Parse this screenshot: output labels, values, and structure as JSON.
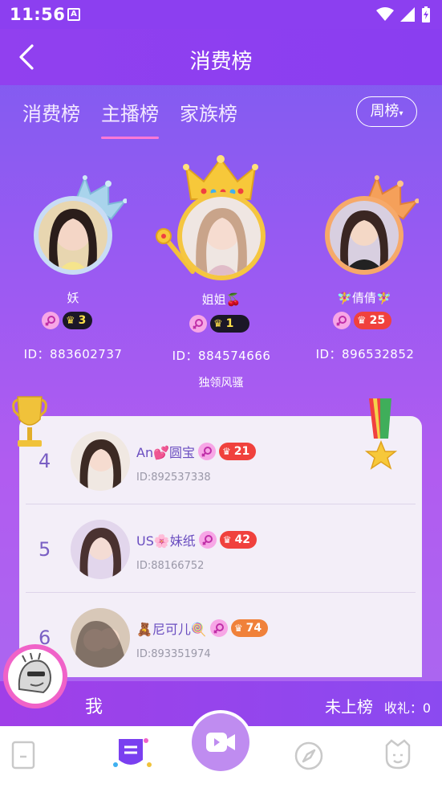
{
  "status_bar": {
    "time": "11:56",
    "a_icon": "A"
  },
  "header": {
    "title": "消费榜",
    "back_icon": "chevron-left-icon"
  },
  "tabs": [
    {
      "label": "消费榜",
      "active": false
    },
    {
      "label": "主播榜",
      "active": true
    },
    {
      "label": "家族榜",
      "active": false
    }
  ],
  "period_select": {
    "label": "周榜"
  },
  "podium": {
    "first": {
      "name": "姐姐🍒",
      "level": "1",
      "id_text": "ID：884574666",
      "slogan": "独领风骚"
    },
    "second": {
      "name": "妖",
      "level": "3",
      "id_text": "ID：883602737"
    },
    "third": {
      "name": "🧚‍♀️倩倩🧚‍♀️",
      "level": "25",
      "id_text": "ID：896532852"
    }
  },
  "ranking_list": [
    {
      "rank": "4",
      "name": "An💕圆宝",
      "level": "21",
      "id_text": "ID:892537338",
      "level_color": "red"
    },
    {
      "rank": "5",
      "name": "US🌸妹纸",
      "level": "42",
      "id_text": "ID:88166752",
      "level_color": "red"
    },
    {
      "rank": "6",
      "name": "🧸尼可儿🍭",
      "level": "74",
      "id_text": "ID:893351974",
      "level_color": "orange"
    }
  ],
  "me": {
    "label": "我",
    "status": "未上榜",
    "gift_text": "收礼：0"
  },
  "colors": {
    "accent": "#8c3ff0",
    "tab_underline": "#ff79d6",
    "level_red": "#f0413d",
    "level_orange": "#f0813a",
    "rank_text": "#7a5fc4"
  }
}
